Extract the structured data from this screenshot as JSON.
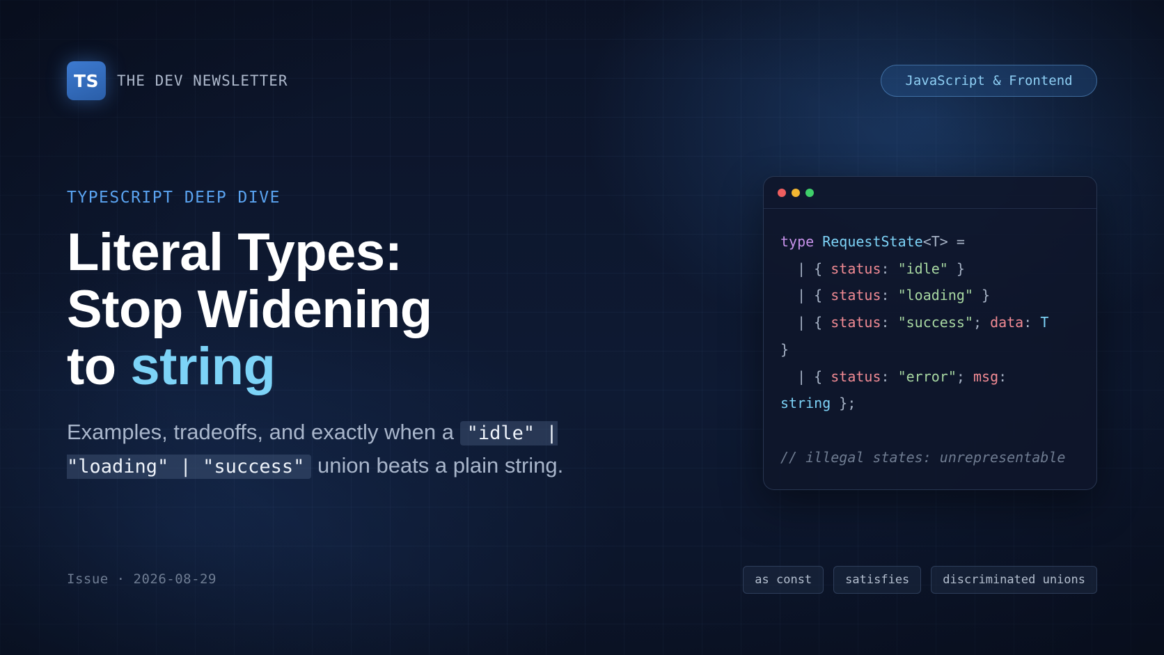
{
  "header": {
    "logo_text": "TS",
    "brand_name": "THE DEV NEWSLETTER",
    "topic_pill": "JavaScript & Frontend"
  },
  "hero": {
    "kicker": "TYPESCRIPT DEEP DIVE",
    "title_line1": "Literal Types:",
    "title_line2": "Stop Widening",
    "title_line3_prefix": "to ",
    "title_line3_accent": "string",
    "subtitle_before": "Examples, tradeoffs, and exactly when a ",
    "subtitle_code": "\"idle\" | \"loading\" | \"success\"",
    "subtitle_after": " union beats a plain string."
  },
  "code_card": {
    "lines": [
      [
        {
          "t": "type",
          "c": "kw"
        },
        {
          "t": " "
        },
        {
          "t": "RequestState",
          "c": "ty"
        },
        {
          "t": "<T> ="
        }
      ],
      [
        {
          "t": "  | { "
        },
        {
          "t": "status",
          "c": "pr"
        },
        {
          "t": ": "
        },
        {
          "t": "\"idle\"",
          "c": "st"
        },
        {
          "t": " }"
        }
      ],
      [
        {
          "t": "  | { "
        },
        {
          "t": "status",
          "c": "pr"
        },
        {
          "t": ": "
        },
        {
          "t": "\"loading\"",
          "c": "st"
        },
        {
          "t": " }"
        }
      ],
      [
        {
          "t": "  | { "
        },
        {
          "t": "status",
          "c": "pr"
        },
        {
          "t": ": "
        },
        {
          "t": "\"success\"",
          "c": "st"
        },
        {
          "t": "; "
        },
        {
          "t": "data",
          "c": "pr"
        },
        {
          "t": ": "
        },
        {
          "t": "T",
          "c": "ty"
        }
      ],
      [
        {
          "t": "}"
        }
      ],
      [
        {
          "t": "  | { "
        },
        {
          "t": "status",
          "c": "pr"
        },
        {
          "t": ": "
        },
        {
          "t": "\"error\"",
          "c": "st"
        },
        {
          "t": "; "
        },
        {
          "t": "msg",
          "c": "pr"
        },
        {
          "t": ":"
        }
      ],
      [
        {
          "t": "string",
          "c": "ty"
        },
        {
          "t": " };"
        }
      ],
      [],
      [
        {
          "t": "// illegal states: unrepresentable",
          "c": "cm"
        }
      ]
    ]
  },
  "footer": {
    "issue": "Issue · 2026-08-29",
    "tags": [
      "as const",
      "satisfies",
      "discriminated unions"
    ]
  },
  "colors": {
    "accent": "#7dd3f7",
    "kicker": "#5aa3f0",
    "logo": "#2a5ea8"
  }
}
